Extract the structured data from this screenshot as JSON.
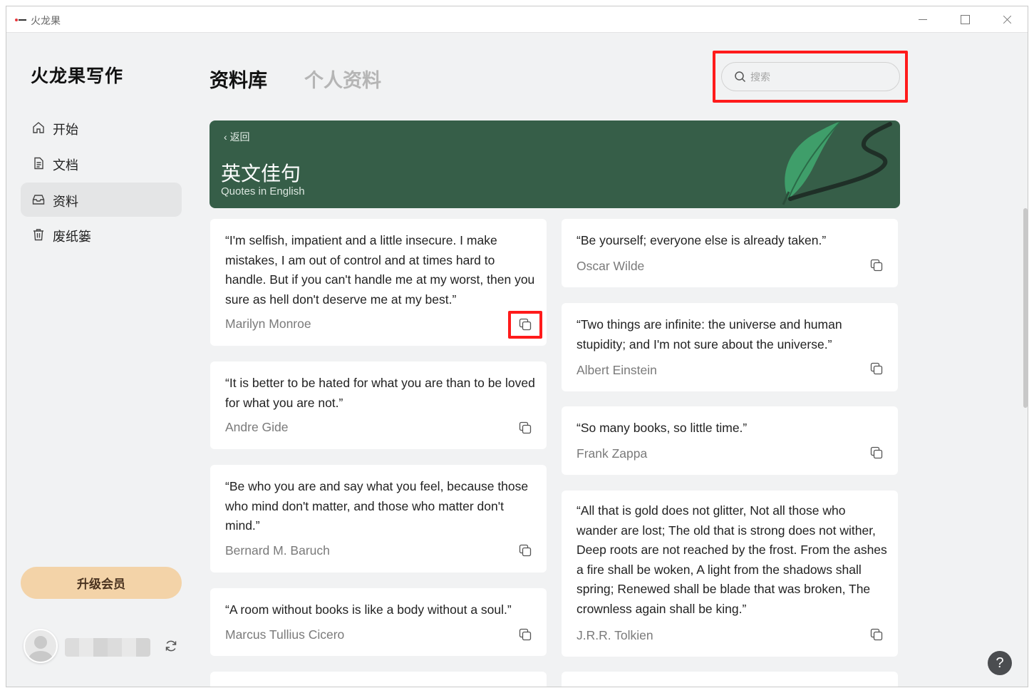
{
  "window": {
    "title": "火龙果"
  },
  "sidebar": {
    "logo": "火龙果写作",
    "items": [
      {
        "label": "开始",
        "icon": "home-icon"
      },
      {
        "label": "文档",
        "icon": "document-icon"
      },
      {
        "label": "资料",
        "icon": "inbox-icon",
        "active": true
      },
      {
        "label": "废纸篓",
        "icon": "trash-icon"
      }
    ],
    "upgrade_label": "升级会员"
  },
  "header": {
    "tab_library": "资料库",
    "tab_personal": "个人资料",
    "search_placeholder": "搜索"
  },
  "banner": {
    "back_label": "返回",
    "title": "英文佳句",
    "subtitle": "Quotes in English",
    "color": "#365e48"
  },
  "cards": [
    {
      "quote": "“I'm selfish, impatient and a little insecure. I make mistakes, I am out of control and at times hard to handle. But if you can't handle me at my worst, then you sure as hell don't deserve me at my best.”",
      "author": "Marilyn Monroe"
    },
    {
      "quote": "“Be yourself; everyone else is already taken.”",
      "author": "Oscar Wilde"
    },
    {
      "quote": "“Two things are infinite: the universe and human stupidity; and I'm not sure about the universe.”",
      "author": "Albert Einstein"
    },
    {
      "quote": "“It is better to be hated for what you are than to be loved for what you are not.”",
      "author": "Andre Gide"
    },
    {
      "quote": "“So many books, so little time.”",
      "author": "Frank Zappa"
    },
    {
      "quote": "“Be who you are and say what you feel, because those who mind don't matter, and those who matter don't mind.”",
      "author": "Bernard M. Baruch"
    },
    {
      "quote": "“All that is gold does not glitter, Not all those who wander are lost; The old that is strong does not wither, Deep roots are not reached by the frost. From the ashes a fire shall be woken, A light from the shadows shall spring; Renewed shall be blade that was broken, The crownless again shall be king.”",
      "author": "J.R.R. Tolkien"
    },
    {
      "quote": "“A room without books is like a body without a soul.”",
      "author": "Marcus Tullius Cicero"
    }
  ],
  "help_label": "?",
  "colors": {
    "highlight": "#ff1b1b",
    "upgrade": "#f3d3a8"
  }
}
